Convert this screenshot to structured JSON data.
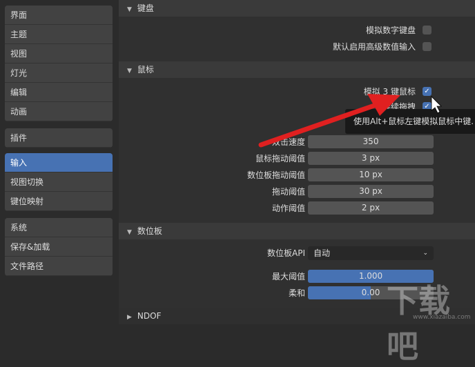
{
  "sidebar": {
    "groups": [
      [
        "界面",
        "主题",
        "视图",
        "灯光",
        "编辑",
        "动画"
      ],
      [
        "插件"
      ],
      [
        "输入",
        "视图切换",
        "键位映射"
      ],
      [
        "系统",
        "保存&加载",
        "文件路径"
      ]
    ],
    "active": "输入"
  },
  "keyboard": {
    "title": "键盘",
    "emulate_numpad": "模拟数字键盘",
    "default_advanced": "默认启用高级数值输入"
  },
  "mouse": {
    "title": "鼠标",
    "emulate_3button": "模拟 3 键鼠标",
    "continuous_grab": "连续拖拽",
    "fields": [
      {
        "label": "双击速度",
        "value": "350"
      },
      {
        "label": "鼠标拖动阈值",
        "value": "3 px"
      },
      {
        "label": "数位板拖动阈值",
        "value": "10 px"
      },
      {
        "label": "拖动阈值",
        "value": "30 px"
      },
      {
        "label": "动作阈值",
        "value": "2 px"
      }
    ]
  },
  "tooltip": "使用Alt+鼠标左键模拟鼠标中键.",
  "tablet": {
    "title": "数位板",
    "api_label": "数位板API",
    "api_value": "自动",
    "max_label": "最大阈值",
    "max_value": "1.000",
    "max_fraction": 1.0,
    "soft_label": "柔和",
    "soft_value": "0.00",
    "soft_fraction": 0.5
  },
  "ndof": {
    "title": "NDOF"
  },
  "watermark": {
    "text": "下载吧",
    "url": "www.xiazaiba.com"
  },
  "colors": {
    "accent": "#4772b3",
    "arrow": "#e02020"
  }
}
